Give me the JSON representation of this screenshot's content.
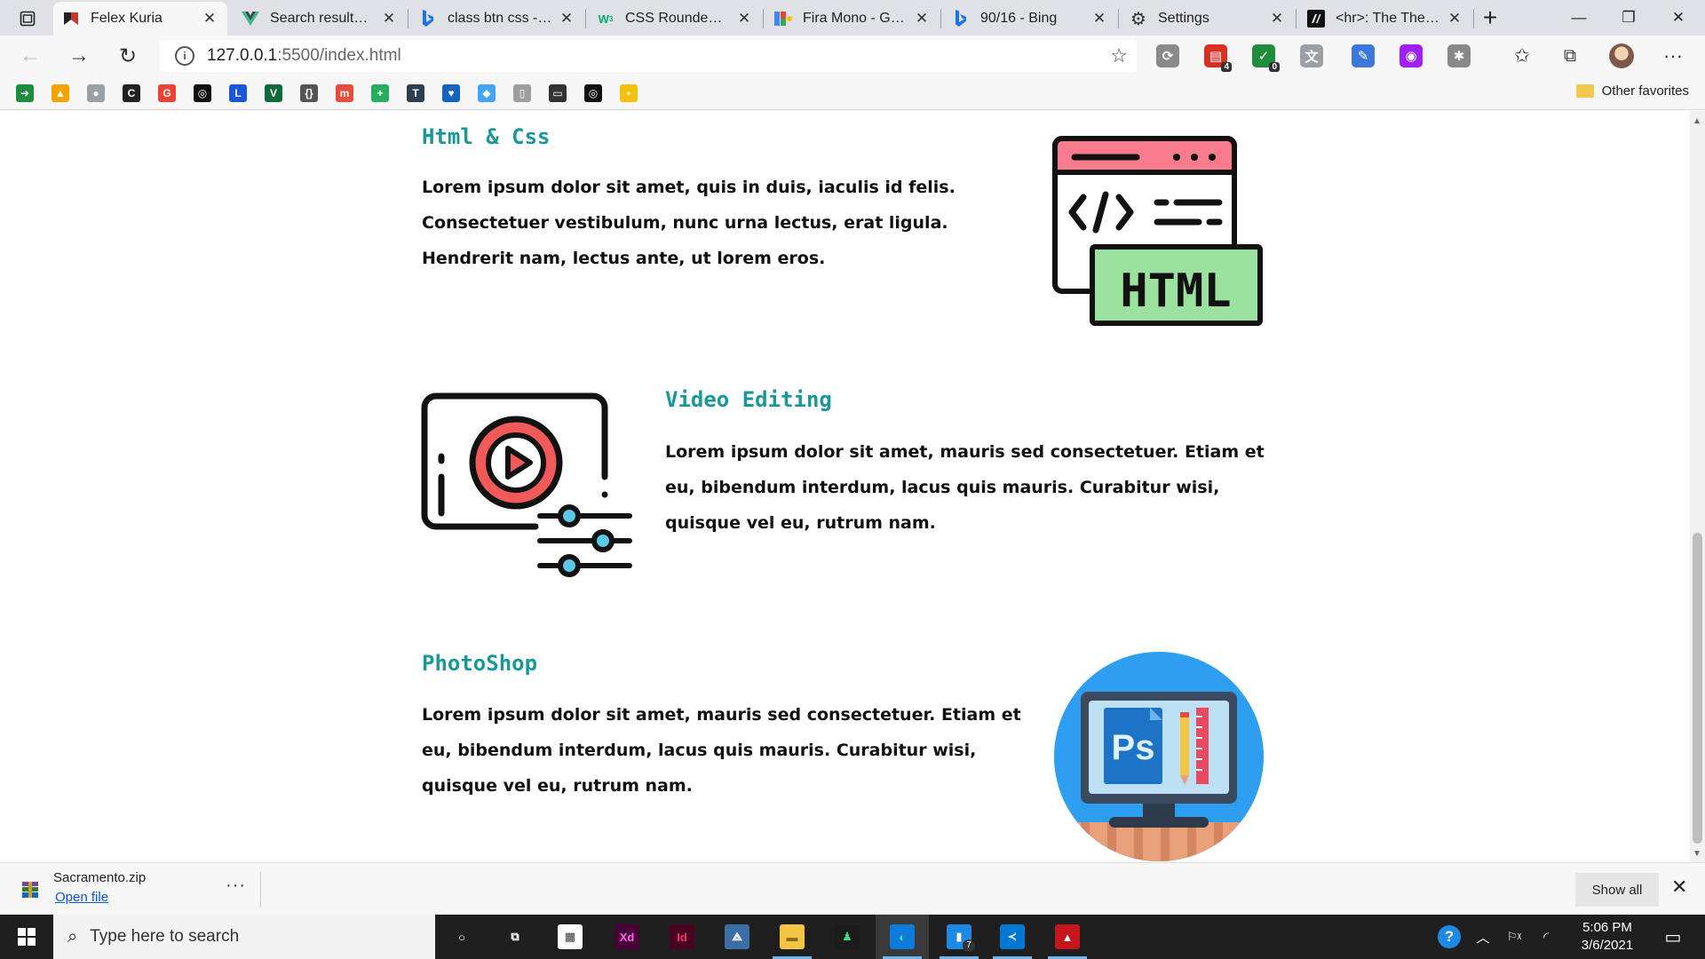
{
  "browser": {
    "tabs": [
      {
        "title": "Felex Kuria",
        "icon": "felex-favicon",
        "color": "#c0392b"
      },
      {
        "title": "Search results for",
        "icon": "vue-favicon",
        "color": "#41b883"
      },
      {
        "title": "class btn css - Bin",
        "icon": "bing-favicon",
        "color": "#1a73e8"
      },
      {
        "title": "CSS Rounded Cor",
        "icon": "w3schools-favicon",
        "color": "#04aa6d"
      },
      {
        "title": "Fira Mono - Goog",
        "icon": "google-fonts-favicon",
        "color": "#ea4335"
      },
      {
        "title": "90/16 - Bing",
        "icon": "bing-favicon",
        "color": "#1a73e8"
      },
      {
        "title": "Settings",
        "icon": "gear-icon",
        "color": "#444444"
      },
      {
        "title": "<hr>: The Thema",
        "icon": "mdn-favicon",
        "color": "#111111"
      }
    ],
    "window_controls": {
      "minimize": "—",
      "restore": "❐",
      "close": "✕"
    },
    "address": {
      "host": "127.0.0.1",
      "rest": ":5500/index.html"
    },
    "extensions": [
      {
        "name": "extension-grey-icon",
        "color": "#8a8a8a",
        "glyph": "⟳",
        "badge": ""
      },
      {
        "name": "extension-red-icon",
        "color": "#d93025",
        "glyph": "▤",
        "badge": "4"
      },
      {
        "name": "extension-green-icon",
        "color": "#1e8e3e",
        "glyph": "✓",
        "badge": "0"
      },
      {
        "name": "extension-translate-icon",
        "color": "#9aa0a6",
        "glyph": "文",
        "badge": ""
      },
      {
        "name": "extension-dropper-icon",
        "color": "#3c78d8",
        "glyph": "✎",
        "badge": ""
      },
      {
        "name": "extension-purple-icon",
        "color": "#a020f0",
        "glyph": "◉",
        "badge": ""
      },
      {
        "name": "extension-bug-icon",
        "color": "#888888",
        "glyph": "✱",
        "badge": ""
      }
    ],
    "favorites": [
      {
        "name": "fav-arrow-icon",
        "color": "#1e8e3e",
        "glyph": "➜"
      },
      {
        "name": "fav-flame-icon",
        "color": "#f4a300",
        "glyph": "▲"
      },
      {
        "name": "fav-circle-icon",
        "color": "#9aa0a6",
        "glyph": "●"
      },
      {
        "name": "fav-c-icon",
        "color": "#222222",
        "glyph": "C"
      },
      {
        "name": "fav-google-icon",
        "color": "#ea4335",
        "glyph": "G"
      },
      {
        "name": "fav-github-icon",
        "color": "#111111",
        "glyph": "◎"
      },
      {
        "name": "fav-l-icon",
        "color": "#1a56db",
        "glyph": "L"
      },
      {
        "name": "fav-v-icon",
        "color": "#0f6b3a",
        "glyph": "V"
      },
      {
        "name": "fav-braces-icon",
        "color": "#555555",
        "glyph": "{}"
      },
      {
        "name": "fav-m-icon",
        "color": "#e74c3c",
        "glyph": "m"
      },
      {
        "name": "fav-plus-icon",
        "color": "#27ae60",
        "glyph": "+"
      },
      {
        "name": "fav-t-icon",
        "color": "#2c3e50",
        "glyph": "T"
      },
      {
        "name": "fav-heart-icon",
        "color": "#1565c0",
        "glyph": "♥"
      },
      {
        "name": "fav-flutter-icon",
        "color": "#42a5f5",
        "glyph": "◆"
      },
      {
        "name": "fav-document-icon",
        "color": "#9e9e9e",
        "glyph": "▯"
      },
      {
        "name": "fav-car-icon",
        "color": "#333333",
        "glyph": "▭"
      },
      {
        "name": "fav-github2-icon",
        "color": "#111111",
        "glyph": "◎"
      },
      {
        "name": "fav-bulb-icon",
        "color": "#f4c20d",
        "glyph": "•"
      }
    ],
    "other_favorites": "Other favorites"
  },
  "page": {
    "sections": [
      {
        "title": "Html & Css",
        "text": "Lorem ipsum dolor sit amet, quis in duis, iaculis id felis. Consectetuer vestibulum, nunc urna lectus, erat ligula. Hendrerit nam, lectus ante, ut lorem eros.",
        "illustration": "html-code-icon",
        "badge_text": "HTML"
      },
      {
        "title": "Video Editing",
        "text": "Lorem ipsum dolor sit amet, mauris sed consectetuer. Etiam et eu, bibendum interdum, lacus quis mauris. Curabitur wisi, quisque vel eu, rutrum nam.",
        "illustration": "video-editing-icon"
      },
      {
        "title": "PhotoShop",
        "text": "Lorem ipsum dolor sit amet, mauris sed consectetuer. Etiam et eu, bibendum interdum, lacus quis mauris. Curabitur wisi, quisque vel eu, rutrum nam.",
        "illustration": "photoshop-monitor-icon",
        "badge_text": "Ps"
      }
    ],
    "colors": {
      "title": "#1a9797",
      "html_bar": "#f87c8c",
      "html_badge": "#9be2a0",
      "video_red": "#f25a5a",
      "slider_dot": "#5bc8e8",
      "ps_circle": "#2e9ef0"
    }
  },
  "download_bar": {
    "filename": "Sacramento.zip",
    "open_label": "Open file",
    "more": "···",
    "show_all": "Show all",
    "close": "✕"
  },
  "taskbar": {
    "search_placeholder": "Type here to search",
    "apps": [
      {
        "name": "cortana-icon",
        "glyph": "○",
        "color": "transparent",
        "fg": "#ffffff"
      },
      {
        "name": "task-view-icon",
        "glyph": "⧉",
        "color": "transparent",
        "fg": "#ffffff"
      },
      {
        "name": "store-icon",
        "glyph": "▦",
        "color": "#ffffff",
        "fg": "#333333"
      },
      {
        "name": "adobe-xd-icon",
        "glyph": "Xd",
        "color": "#470137",
        "fg": "#ff61f6"
      },
      {
        "name": "adobe-indesign-icon",
        "glyph": "Id",
        "color": "#49021f",
        "fg": "#ff3366"
      },
      {
        "name": "mysql-workbench-icon",
        "glyph": "⟁",
        "color": "#3a6ea5",
        "fg": "#ffffff"
      },
      {
        "name": "file-explorer-icon",
        "glyph": "▬",
        "color": "#f4c542",
        "fg": "#8a6d1a"
      },
      {
        "name": "gitkraken-icon",
        "glyph": "♟",
        "color": "#1b1b1b",
        "fg": "#3ddc84"
      },
      {
        "name": "edge-icon",
        "glyph": "◐",
        "color": "#0c7bdc",
        "fg": "#5fe19b"
      },
      {
        "name": "phone-app-icon",
        "glyph": "▮",
        "color": "#1e88e5",
        "fg": "#ffffff"
      },
      {
        "name": "vscode-icon",
        "glyph": "≺",
        "color": "#0078d4",
        "fg": "#ffffff"
      },
      {
        "name": "acrobat-icon",
        "glyph": "▲",
        "color": "#c4161c",
        "fg": "#ffffff"
      }
    ],
    "phone_badge": "7",
    "clock_time": "5:06 PM",
    "clock_date": "3/6/2021"
  }
}
